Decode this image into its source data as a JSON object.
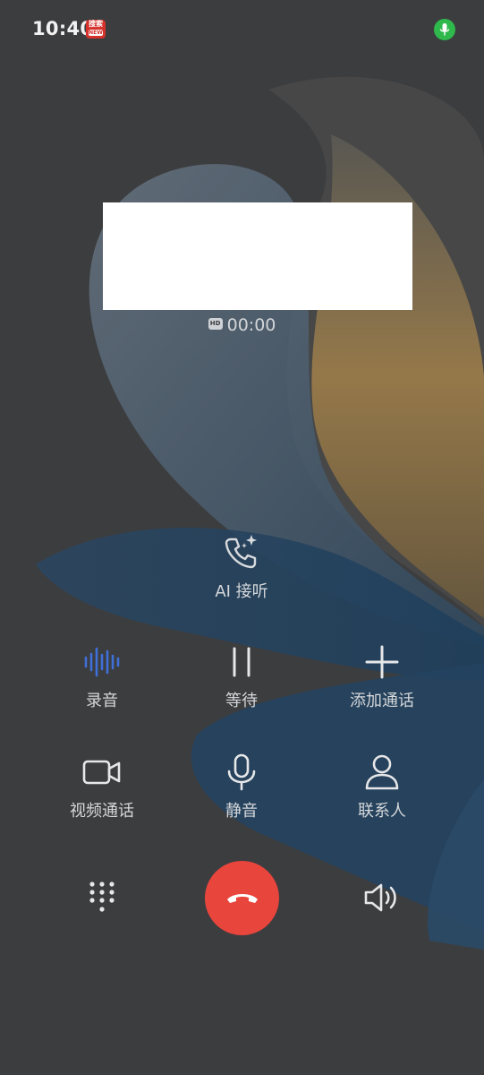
{
  "status_bar": {
    "time": "10:40",
    "badge_top": "搜索",
    "badge_sub": "NEW"
  },
  "call": {
    "timer": "00:00",
    "hd_badge": "HD"
  },
  "ai_answer": {
    "label": "AI 接听",
    "icon": "phone-sparkle-icon"
  },
  "controls_row1": [
    {
      "label": "录音",
      "icon": "record-waveform-icon",
      "accent": "#3f6fd8"
    },
    {
      "label": "等待",
      "icon": "pause-icon"
    },
    {
      "label": "添加通话",
      "icon": "plus-icon"
    }
  ],
  "controls_row2": [
    {
      "label": "视频通话",
      "icon": "video-camera-icon"
    },
    {
      "label": "静音",
      "icon": "microphone-icon"
    },
    {
      "label": "联系人",
      "icon": "contact-person-icon"
    }
  ],
  "bottom_bar": {
    "keypad_icon": "dialpad-icon",
    "end_icon": "hang-up-icon",
    "speaker_icon": "speaker-icon",
    "end_color": "#e8453c"
  }
}
